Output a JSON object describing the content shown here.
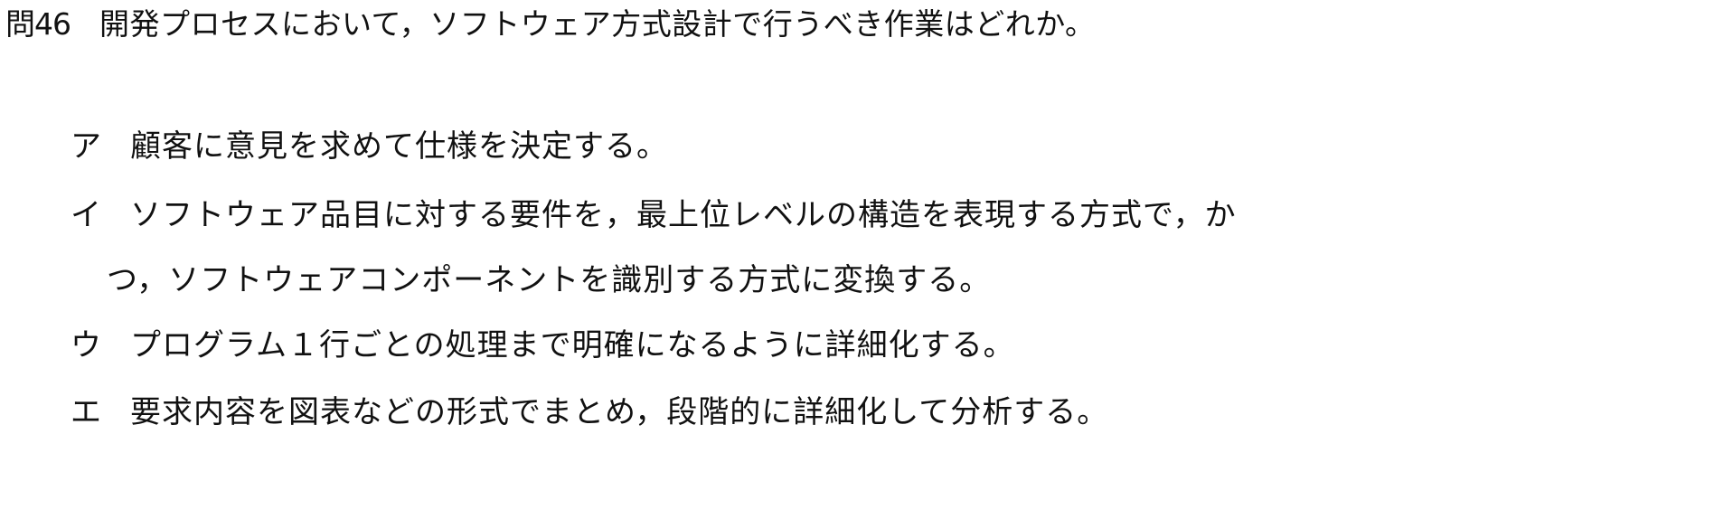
{
  "question": {
    "number": "問46",
    "text": "開発プロセスにおいて，ソフトウェア方式設計で行うべき作業はどれか。"
  },
  "choices": [
    {
      "label": "ア",
      "text": "顧客に意見を求めて仕様を決定する。"
    },
    {
      "label": "イ",
      "text": "ソフトウェア品目に対する要件を，最上位レベルの構造を表現する方式で，か",
      "continuation": "つ，ソフトウェアコンポーネントを識別する方式に変換する。"
    },
    {
      "label": "ウ",
      "text": "プログラム１行ごとの処理まで明確になるように詳細化する。"
    },
    {
      "label": "エ",
      "text": "要求内容を図表などの形式でまとめ，段階的に詳細化して分析する。"
    }
  ]
}
